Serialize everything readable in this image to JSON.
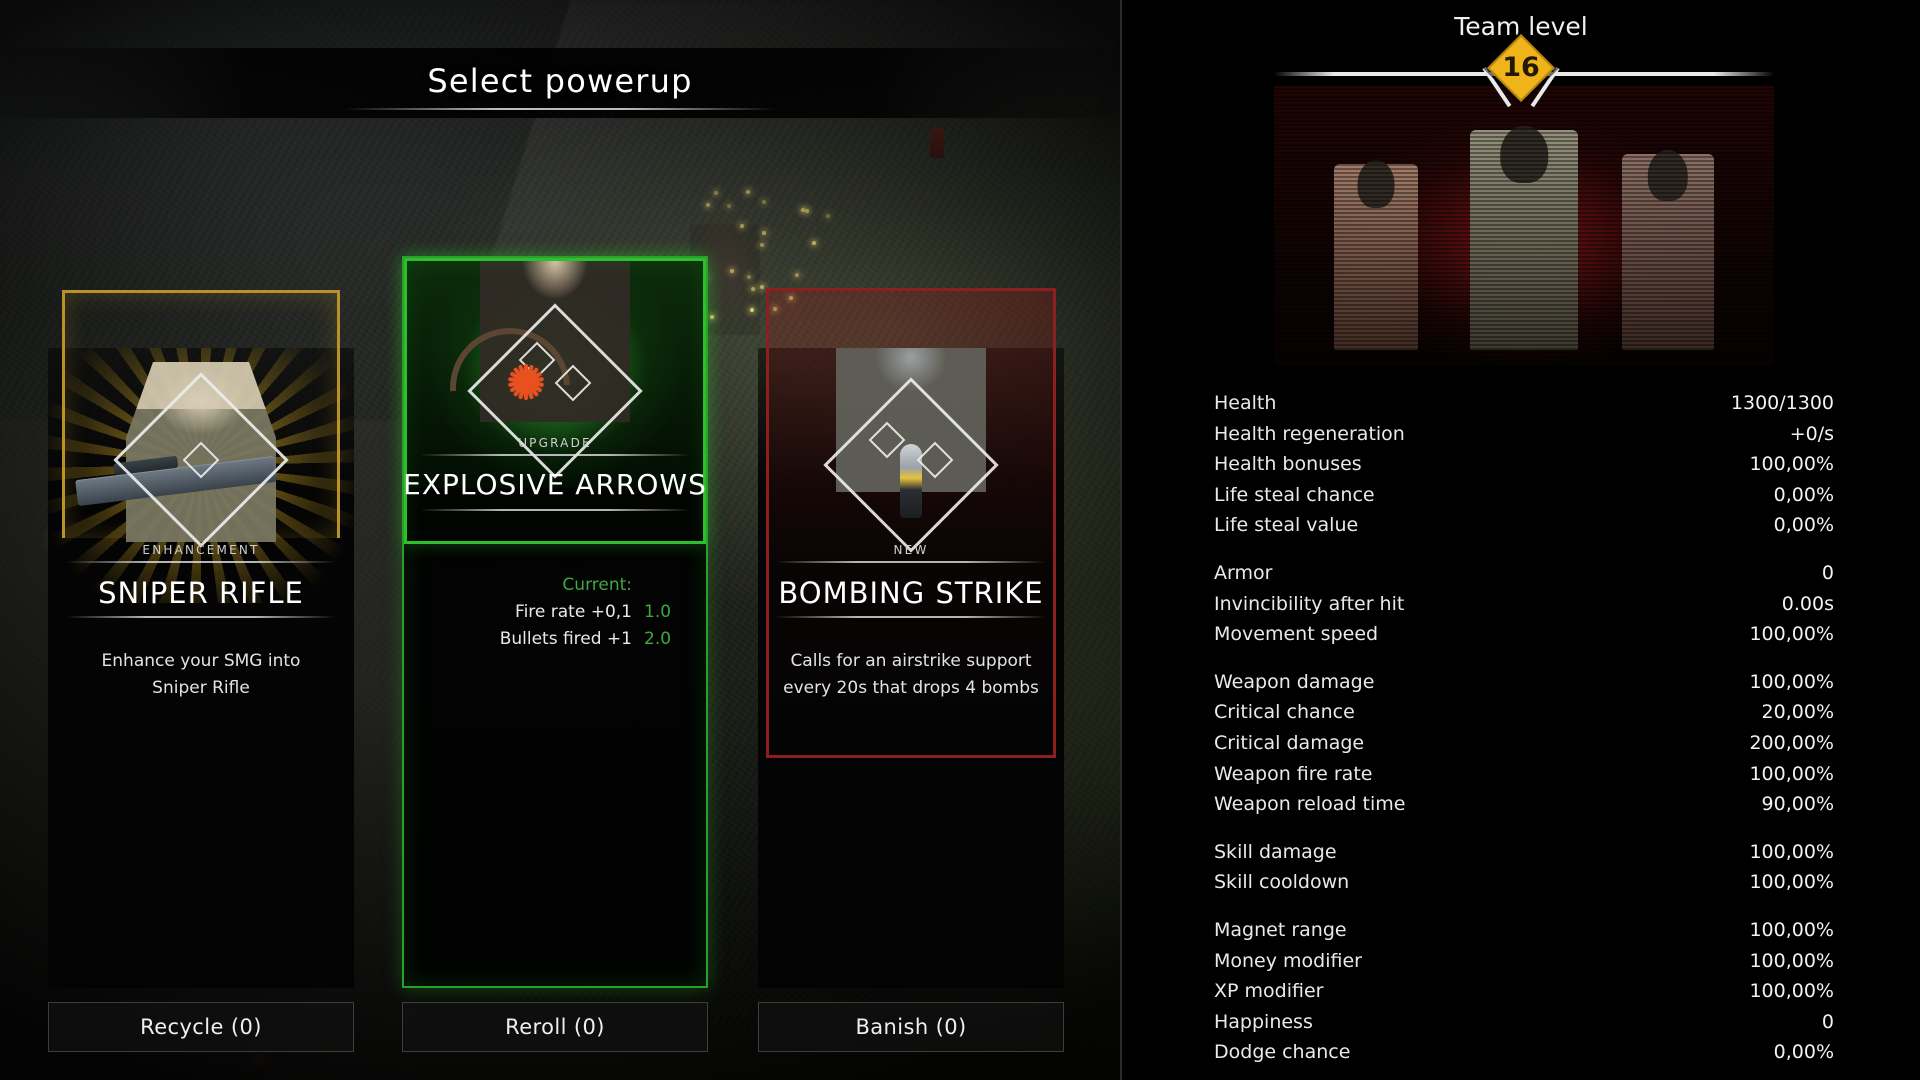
{
  "header": {
    "title": "Select powerup"
  },
  "cards": [
    {
      "tag": "ENHANCEMENT",
      "name": "SNIPER RIFLE",
      "description": "Enhance your SMG into Sniper Rifle",
      "frame_color": "#b8902c",
      "icon": "sniper-soldier-icon"
    },
    {
      "tag": "UPGRADE",
      "name": "EXPLOSIVE ARROWS",
      "description": "",
      "frame_color": "#2fbf2f",
      "icon": "archer-bow-icon",
      "current_label": "Current:",
      "stats": [
        {
          "key": "Fire rate +0,1",
          "value": "1.0"
        },
        {
          "key": "Bullets fired +1",
          "value": "2.0"
        }
      ]
    },
    {
      "tag": "NEW",
      "name": "BOMBING STRIKE",
      "description": "Calls for an airstrike support every 20s that drops 4 bombs",
      "frame_color": "#8c1f1f",
      "icon": "bomber-pilot-icon"
    }
  ],
  "buttons": {
    "recycle": "Recycle (0)",
    "reroll": "Reroll (0)",
    "banish": "Banish (0)"
  },
  "panel": {
    "title": "Team level",
    "level": "16",
    "stat_groups": [
      [
        {
          "label": "Health",
          "value": "1300/1300"
        },
        {
          "label": "Health regeneration",
          "value": "+0/s"
        },
        {
          "label": "Health bonuses",
          "value": "100,00%"
        },
        {
          "label": "Life steal chance",
          "value": "0,00%"
        },
        {
          "label": "Life steal value",
          "value": "0,00%"
        }
      ],
      [
        {
          "label": "Armor",
          "value": "0"
        },
        {
          "label": "Invincibility after hit",
          "value": "0.00s"
        },
        {
          "label": "Movement speed",
          "value": "100,00%"
        }
      ],
      [
        {
          "label": "Weapon damage",
          "value": "100,00%"
        },
        {
          "label": "Critical chance",
          "value": "20,00%"
        },
        {
          "label": "Critical damage",
          "value": "200,00%"
        },
        {
          "label": "Weapon fire rate",
          "value": "100,00%"
        },
        {
          "label": "Weapon reload time",
          "value": "90,00%"
        }
      ],
      [
        {
          "label": "Skill damage",
          "value": "100,00%"
        },
        {
          "label": "Skill cooldown",
          "value": "100,00%"
        }
      ],
      [
        {
          "label": "Magnet range",
          "value": "100,00%"
        },
        {
          "label": "Money modifier",
          "value": "100,00%"
        },
        {
          "label": "XP modifier",
          "value": "100,00%"
        },
        {
          "label": "Happiness",
          "value": "0"
        },
        {
          "label": "Dodge chance",
          "value": "0,00%"
        }
      ]
    ]
  }
}
